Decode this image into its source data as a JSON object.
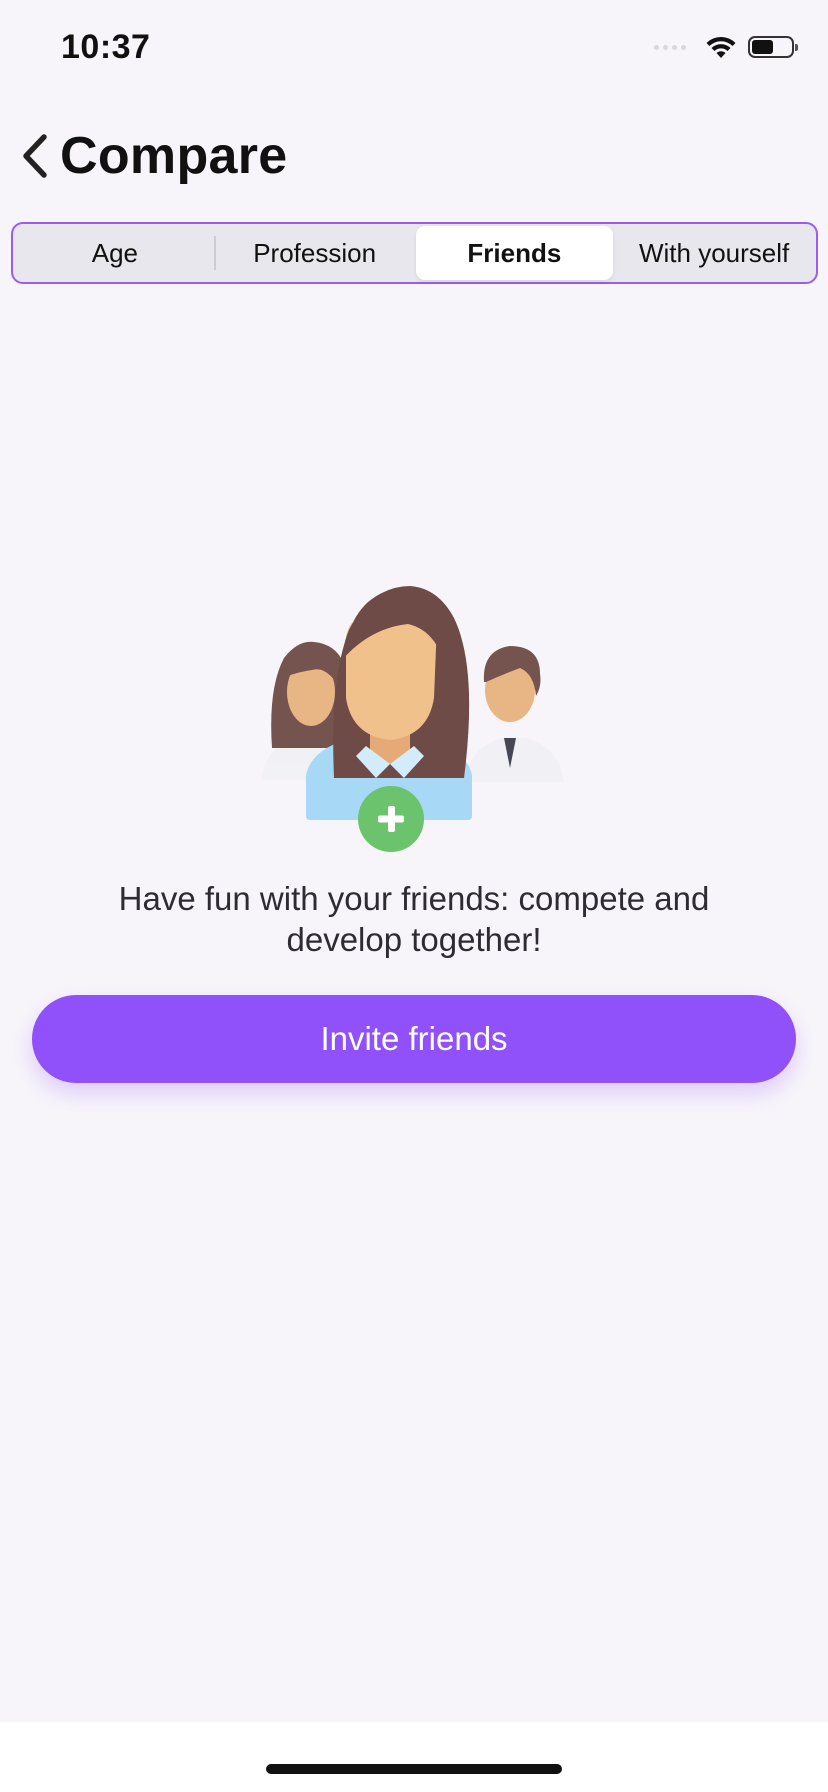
{
  "status_bar": {
    "time": "10:37",
    "battery_level": 0.55,
    "icons": [
      "signal-icon",
      "wifi-icon",
      "battery-icon"
    ]
  },
  "header": {
    "title": "Compare",
    "back_icon": "chevron-left-icon"
  },
  "tabs": [
    {
      "label": "Age",
      "active": false
    },
    {
      "label": "Profession",
      "active": false
    },
    {
      "label": "Friends",
      "active": true
    },
    {
      "label": "With yourself",
      "active": false
    }
  ],
  "main": {
    "illustration": "friends-group-add-icon",
    "message": "Have fun with your friends: compete and develop together!",
    "invite_label": "Invite friends"
  },
  "colors": {
    "accent": "#9050fa",
    "tab_border": "#9c5cf0",
    "background": "#f8f5fa",
    "add_badge": "#6cc36d"
  }
}
